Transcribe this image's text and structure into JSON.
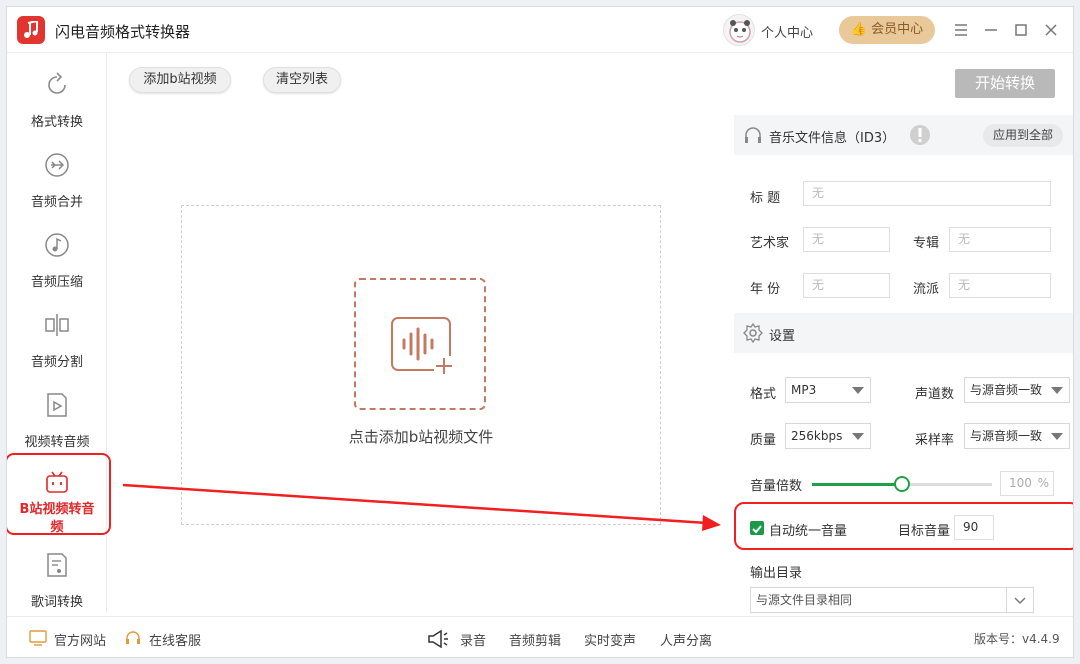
{
  "app": {
    "title": "闪电音频格式转换器"
  },
  "header": {
    "personal_label": "个人中心",
    "vip_label": "会员中心"
  },
  "sidebar": {
    "items": [
      {
        "label": "格式转换",
        "icon": "refresh-icon"
      },
      {
        "label": "音频合并",
        "icon": "merge-icon"
      },
      {
        "label": "音频压缩",
        "icon": "music-note-icon"
      },
      {
        "label": "音频分割",
        "icon": "split-icon"
      },
      {
        "label": "视频转音频",
        "icon": "video-icon"
      },
      {
        "label": "B站视频转音频",
        "icon": "bilibili-icon",
        "active": true
      },
      {
        "label": "歌词转换",
        "icon": "lyrics-icon"
      }
    ]
  },
  "toolbar": {
    "add_label": "添加b站视频",
    "clear_label": "清空列表",
    "start_label": "开始转换"
  },
  "dropzone": {
    "text": "点击添加b站视频文件"
  },
  "id3": {
    "title": "音乐文件信息（ID3）",
    "apply_all": "应用到全部",
    "fields": {
      "title_label": "标  题",
      "artist_label": "艺术家",
      "album_label": "专辑",
      "year_label": "年  份",
      "genre_label": "流派",
      "placeholder": "无"
    }
  },
  "settings": {
    "title": "设置",
    "format_label": "格式",
    "format_value": "MP3",
    "channel_label": "声道数",
    "channel_value": "与源音频一致",
    "quality_label": "质量",
    "quality_value": "256kbps",
    "samplerate_label": "采样率",
    "samplerate_value": "与源音频一致",
    "volume_label": "音量倍数",
    "volume_value": "100",
    "volume_unit": "%",
    "volume_fraction": 0.5,
    "auto_volume_label": "自动统一音量",
    "auto_volume_checked": true,
    "target_volume_label": "目标音量",
    "target_volume_value": "90",
    "output_label": "输出目录",
    "output_value": "与源文件目录相同"
  },
  "footer": {
    "website": "官方网站",
    "support": "在线客服",
    "record": "录音",
    "edit": "音频剪辑",
    "pitch": "实时变声",
    "vocal": "人声分离",
    "version": "版本号：v4.4.9"
  },
  "colors": {
    "accent": "#e3352f",
    "green": "#21a04a",
    "highlight": "#f02020",
    "vip": "#e9c99a"
  }
}
